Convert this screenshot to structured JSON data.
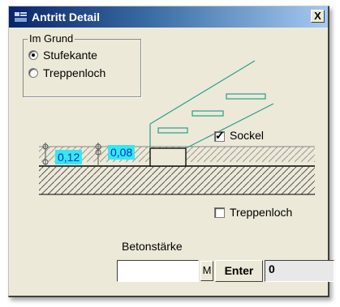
{
  "window": {
    "title": "Antritt Detail",
    "close_label": "X"
  },
  "grund_group": {
    "legend": "Im Grund",
    "options": [
      {
        "label": "Stufekante",
        "selected": true
      },
      {
        "label": "Treppenloch",
        "selected": false
      }
    ]
  },
  "drawing": {
    "left_value": "0,12",
    "right_value": "0,08",
    "accent_color": "#2a9d8f",
    "value_box_color": "#36e7ef"
  },
  "sockel": {
    "label": "Sockel",
    "checked": true
  },
  "treppenloch": {
    "label": "Treppenloch",
    "checked": false
  },
  "betonstaerke": {
    "label": "Betonstärke",
    "input_value": "",
    "m_label": "M",
    "enter_label": "Enter",
    "result_value": "0"
  }
}
